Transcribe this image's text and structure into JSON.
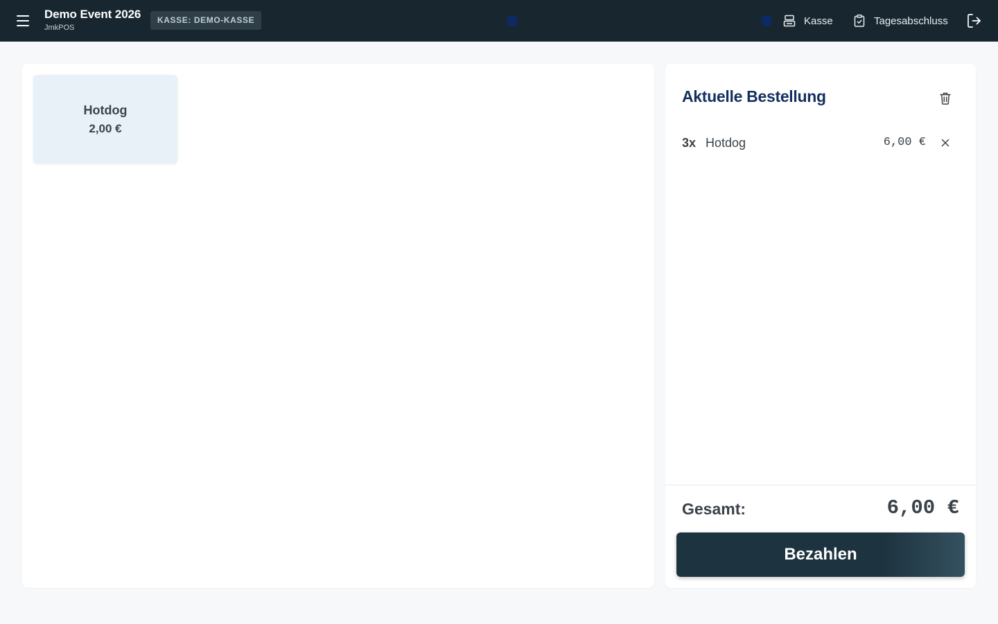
{
  "header": {
    "event_title": "Demo Event 2026",
    "app_name": "JmkPOS",
    "register_badge": "KASSE: DEMO-KASSE",
    "nav": {
      "register_label": "Kasse",
      "daily_closing_label": "Tagesabschluss"
    },
    "status_color": "#0d2a66"
  },
  "products": [
    {
      "name": "Hotdog",
      "price": "2,00 €"
    }
  ],
  "order": {
    "title": "Aktuelle Bestellung",
    "items": [
      {
        "qty": "3x",
        "name": "Hotdog",
        "price": "6,00 €"
      }
    ],
    "total_label": "Gesamt:",
    "total_value": "6,00 €",
    "pay_label": "Bezahlen"
  },
  "colors": {
    "topbar": "#18272f",
    "accent_title": "#13305e",
    "pay_button": "#1d3340",
    "product_tile": "#e8f1f8"
  }
}
